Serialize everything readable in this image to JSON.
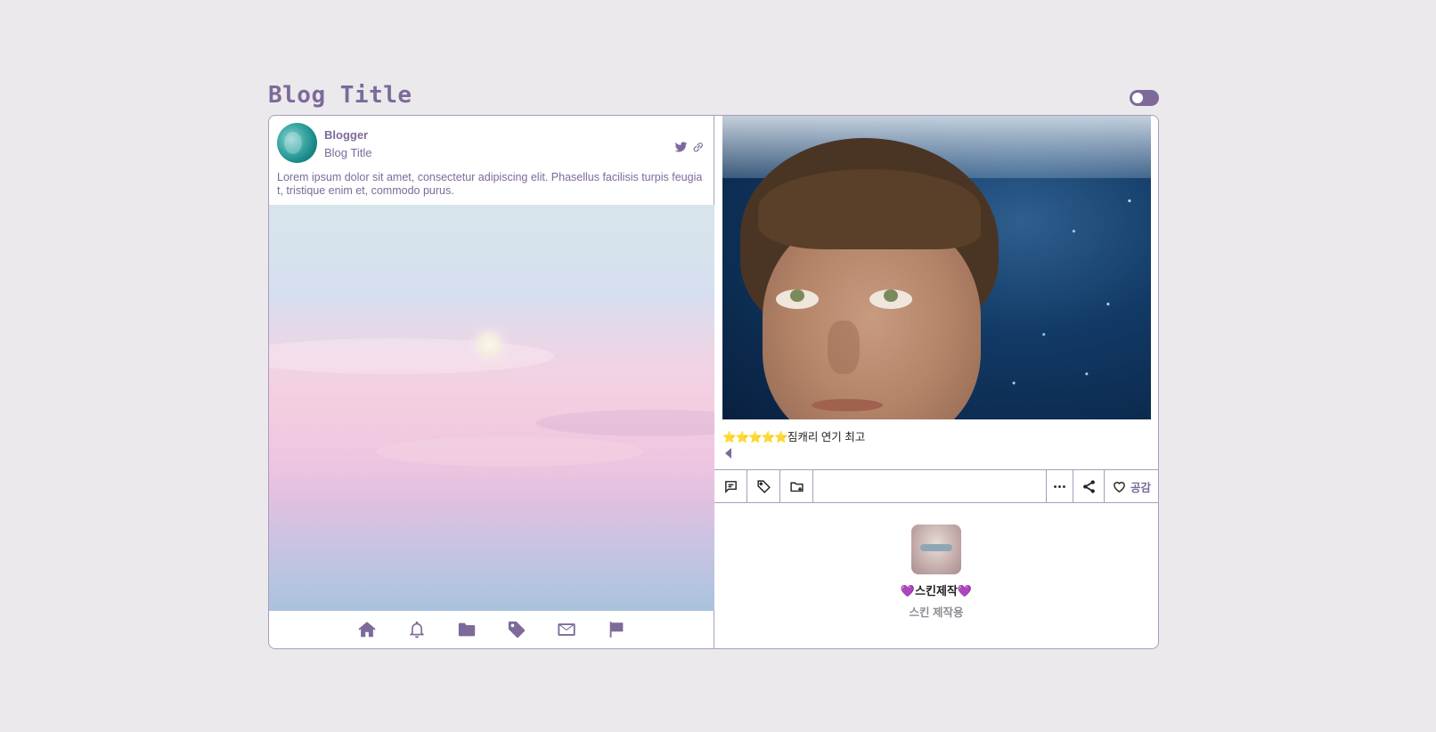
{
  "header": {
    "title": "Blog Title"
  },
  "profile": {
    "name": "Blogger",
    "subtitle": "Blog Title",
    "description": "Lorem ipsum dolor sit amet, consectetur adipiscing elit. Phasellus facilisis turpis feugiat, tristique enim et, commodo purus.",
    "icons": [
      "twitter-icon",
      "link-icon"
    ]
  },
  "nav": {
    "icons": [
      "home-icon",
      "bell-icon",
      "folder-icon",
      "tag-icon",
      "mail-icon",
      "flag-icon"
    ]
  },
  "post": {
    "rating_stars": "⭐⭐⭐⭐⭐",
    "review_text": "짐캐리 연기 최고"
  },
  "toolbar": {
    "like_label": "공감"
  },
  "author": {
    "name_heart": "💜",
    "name": "스킨제작",
    "subtitle": "스킨 제작용"
  },
  "colors": {
    "accent": "#7d6a9a",
    "background": "#ebe9ec",
    "border": "#a99cbd"
  }
}
